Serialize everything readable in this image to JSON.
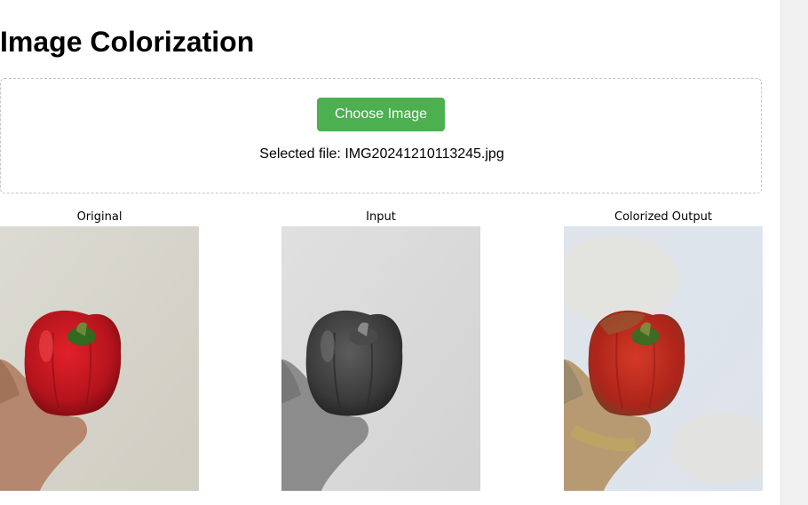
{
  "page": {
    "title": "Image Colorization"
  },
  "upload": {
    "button_label": "Choose Image",
    "selected_file_text": "Selected file: IMG20241210113245.jpg"
  },
  "results": [
    {
      "caption": "Original",
      "image_kind": "color-photo-red-bell-pepper-in-hand"
    },
    {
      "caption": "Input",
      "image_kind": "grayscale-photo-bell-pepper-in-hand"
    },
    {
      "caption": "Colorized Output",
      "image_kind": "colorized-photo-bell-pepper-in-hand"
    }
  ],
  "colors": {
    "button_green": "#4caf50",
    "dropzone_border": "#c4c4c4"
  }
}
